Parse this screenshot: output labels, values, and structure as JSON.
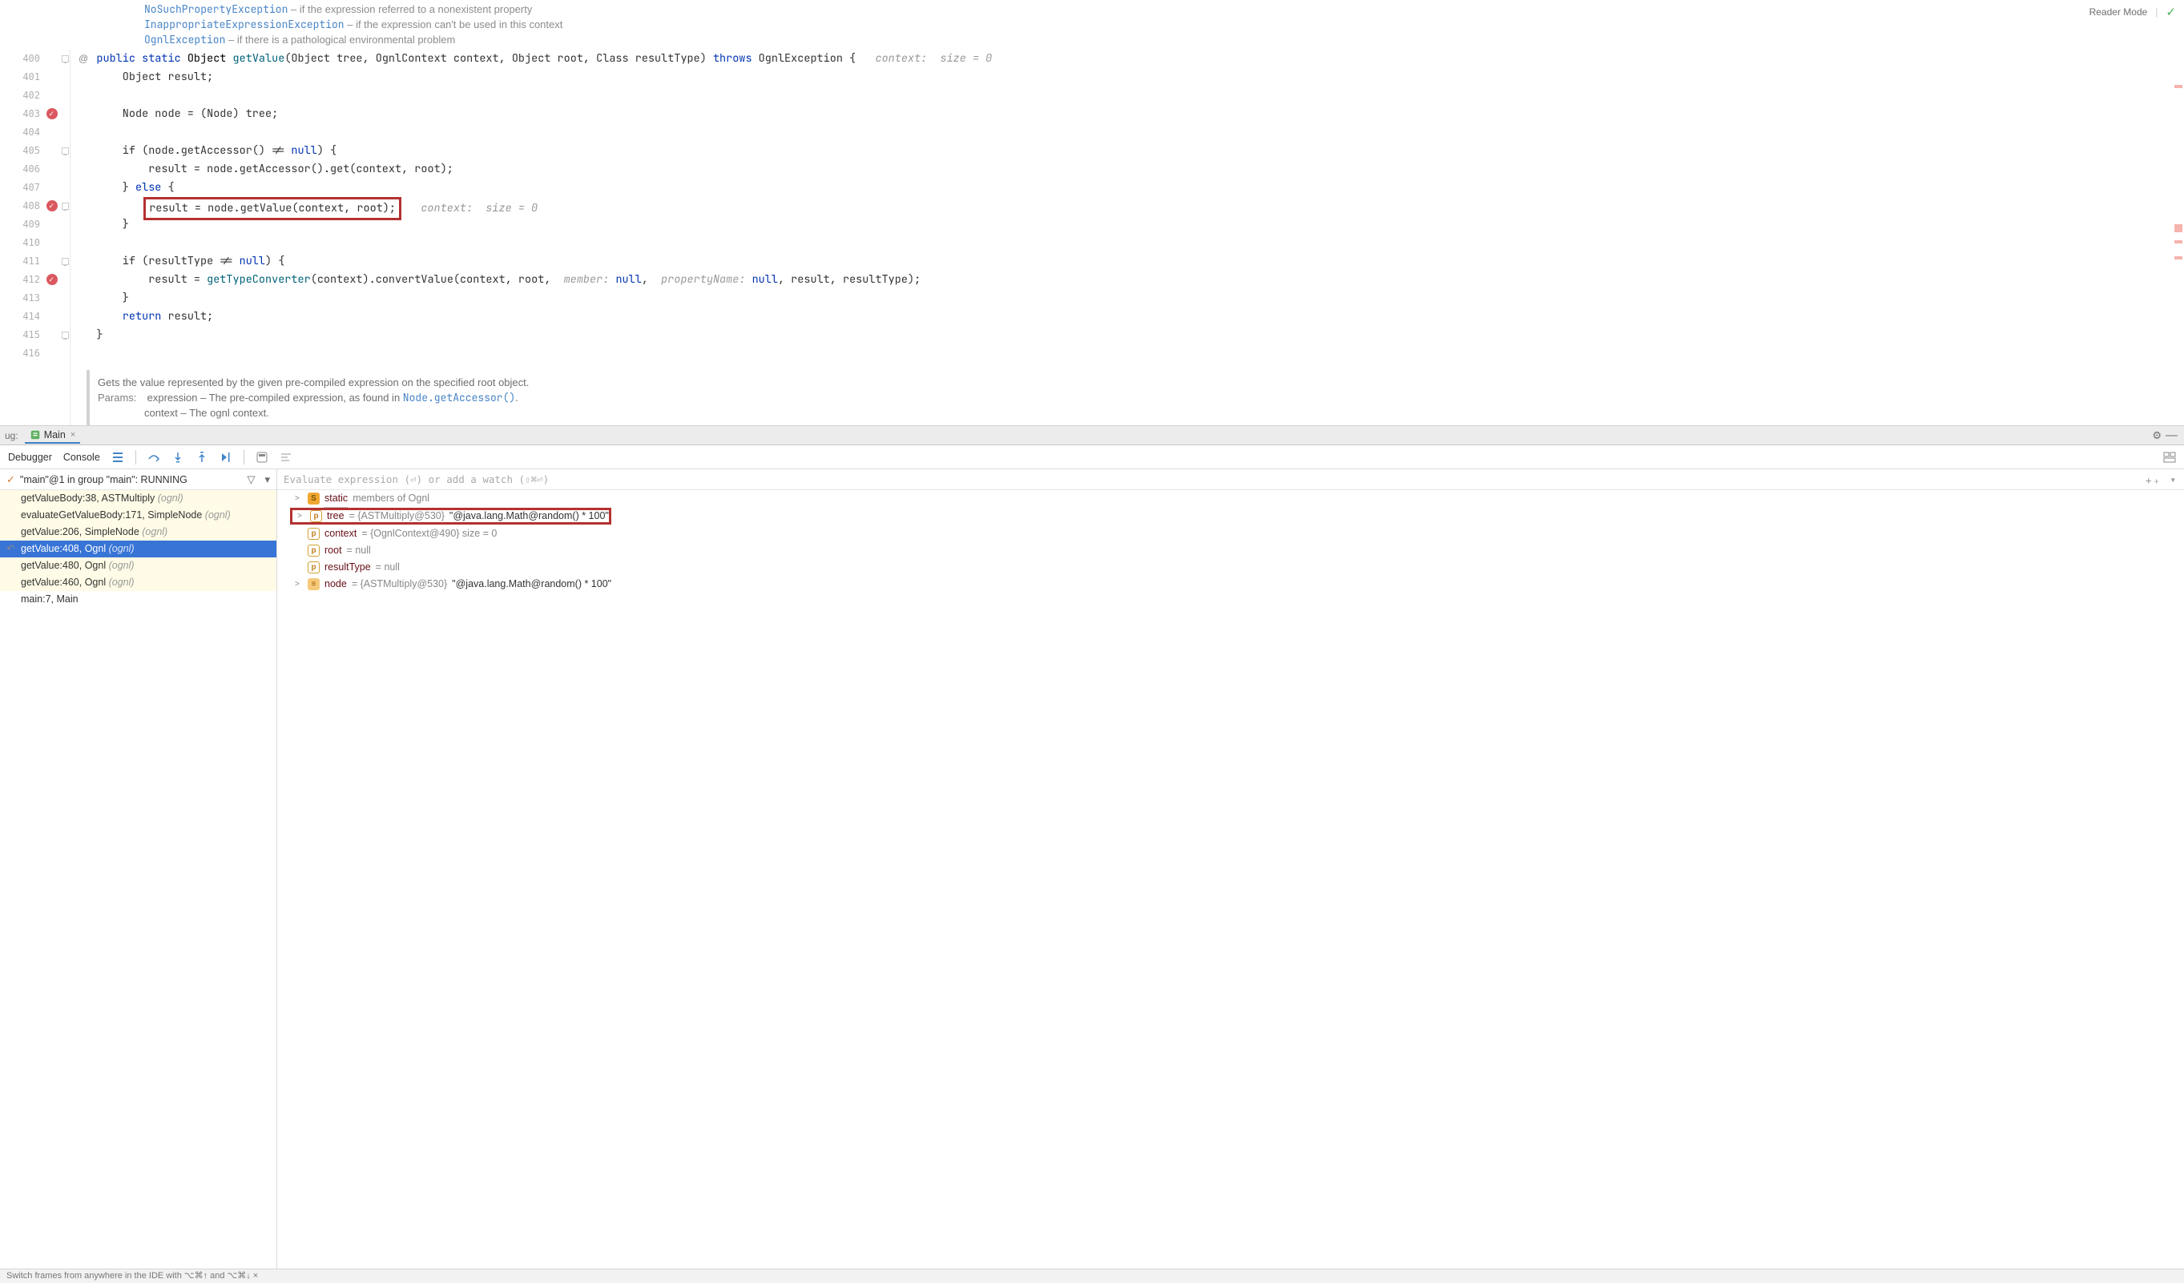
{
  "reader_mode": "Reader Mode",
  "exceptions": [
    {
      "name": "NoSuchPropertyException",
      "desc": " – if the expression referred to a nonexistent property"
    },
    {
      "name": "InappropriateExpressionException",
      "desc": " – if the expression can't be used in this context"
    },
    {
      "name": "OgnlException",
      "desc": " – if there is a pathological environmental problem"
    }
  ],
  "gutter_start": 400,
  "at_line": 400,
  "breakpoints": [
    403,
    408,
    412
  ],
  "highlighted_blue": 408,
  "highlighted_red": [
    403,
    412
  ],
  "code_lines": {
    "400": {
      "pre": "    ",
      "tokens": [
        {
          "t": "public ",
          "c": "kw"
        },
        {
          "t": "static ",
          "c": "kw"
        },
        {
          "t": "Object ",
          "c": "type"
        },
        {
          "t": "getValue",
          "c": "method"
        },
        {
          "t": "(Object tree, OgnlContext context, Object root, Class<?> resultType) "
        },
        {
          "t": "throws ",
          "c": "kw"
        },
        {
          "t": "OgnlException {   "
        },
        {
          "t": "context:  size = 0",
          "c": "hint"
        }
      ]
    },
    "401": {
      "pre": "        ",
      "tokens": [
        {
          "t": "Object result;"
        }
      ]
    },
    "402": {
      "pre": "",
      "tokens": [
        {
          "t": ""
        }
      ]
    },
    "403": {
      "pre": "        ",
      "tokens": [
        {
          "t": "Node node = (Node) tree;"
        }
      ]
    },
    "404": {
      "pre": "",
      "tokens": [
        {
          "t": ""
        }
      ]
    },
    "405": {
      "pre": "        ",
      "tokens": [
        {
          "t": "if "
        },
        {
          "t": "(node.getAccessor() != "
        },
        {
          "t": "null",
          "c": "kw"
        },
        {
          "t": ") {"
        }
      ]
    },
    "406": {
      "pre": "            ",
      "tokens": [
        {
          "t": "result = node.getAccessor().get(context, root);"
        }
      ]
    },
    "407": {
      "pre": "        ",
      "tokens": [
        {
          "t": "} "
        },
        {
          "t": "else",
          "c": "kw"
        },
        {
          "t": " {"
        }
      ]
    },
    "408": {
      "pre": "            ",
      "boxed": true,
      "tokens": [
        {
          "t": "result = node.getValue(context, root);"
        }
      ],
      "hint": "   context:  size = 0"
    },
    "409": {
      "pre": "        ",
      "tokens": [
        {
          "t": "}"
        }
      ]
    },
    "410": {
      "pre": "",
      "tokens": [
        {
          "t": ""
        }
      ]
    },
    "411": {
      "pre": "        ",
      "tokens": [
        {
          "t": "if "
        },
        {
          "t": "(resultType != "
        },
        {
          "t": "null",
          "c": "kw"
        },
        {
          "t": ") {"
        }
      ]
    },
    "412": {
      "pre": "            ",
      "tokens": [
        {
          "t": "result = "
        },
        {
          "t": "getTypeConverter",
          "c": "method i"
        },
        {
          "t": "(context).convertValue(context, root,  "
        },
        {
          "t": "member: ",
          "c": "hint"
        },
        {
          "t": "null",
          "c": "kw"
        },
        {
          "t": ",  "
        },
        {
          "t": "propertyName: ",
          "c": "hint"
        },
        {
          "t": "null",
          "c": "kw"
        },
        {
          "t": ", result, resultType);"
        }
      ]
    },
    "413": {
      "pre": "        ",
      "tokens": [
        {
          "t": "}"
        }
      ]
    },
    "414": {
      "pre": "        ",
      "tokens": [
        {
          "t": "return ",
          "c": "kw"
        },
        {
          "t": "result;"
        }
      ]
    },
    "415": {
      "pre": "    ",
      "tokens": [
        {
          "t": "}"
        }
      ]
    },
    "416": {
      "pre": "",
      "tokens": [
        {
          "t": ""
        }
      ]
    }
  },
  "doc": {
    "summary": "Gets the value represented by the given pre-compiled expression on the specified root object.",
    "params_label": "Params:",
    "p1": "expression – The pre-compiled expression, as found in ",
    "p1_link": "Node.getAccessor()",
    "p1_end": ".",
    "p2": "context – The ognl context."
  },
  "debug_label": "ug:",
  "run_tab": "Main",
  "toolbar_tabs": {
    "debugger": "Debugger",
    "console": "Console"
  },
  "thread_line": "\"main\"@1 in group \"main\": RUNNING",
  "frames": [
    {
      "txt": "getValueBody:38, ASTMultiply",
      "pkg": "(ognl)"
    },
    {
      "txt": "evaluateGetValueBody:171, SimpleNode",
      "pkg": "(ognl)"
    },
    {
      "txt": "getValue:206, SimpleNode",
      "pkg": "(ognl)"
    },
    {
      "txt": "getValue:408, Ognl",
      "pkg": "(ognl)",
      "sel": true,
      "dropped": true
    },
    {
      "txt": "getValue:480, Ognl",
      "pkg": "(ognl)"
    },
    {
      "txt": "getValue:460, Ognl",
      "pkg": "(ognl)"
    },
    {
      "txt": "main:7, Main",
      "pkg": "",
      "plain": true
    }
  ],
  "watch_placeholder": "Evaluate expression (⏎) or add a watch (⇧⌘⏎)",
  "vars": [
    {
      "exp": ">",
      "b": "s",
      "name": "static",
      "rest": " members of Ognl",
      "name_dotted": true
    },
    {
      "exp": ">",
      "b": "p",
      "name": "tree",
      "rest": " = {ASTMultiply@530} ",
      "str": "\"@java.lang.Math@random() * 100\"",
      "boxed": true
    },
    {
      "exp": " ",
      "b": "p",
      "name": "context",
      "rest": " = {OgnlContext@490}  size = 0"
    },
    {
      "exp": " ",
      "b": "p",
      "name": "root",
      "rest": " = null"
    },
    {
      "exp": " ",
      "b": "p",
      "name": "resultType",
      "rest": " = null"
    },
    {
      "exp": ">",
      "b": "f",
      "name": "node",
      "rest": " = {ASTMultiply@530} ",
      "str": "\"@java.lang.Math@random() * 100\""
    }
  ],
  "status": "Switch frames from anywhere in the IDE with ⌥⌘↑ and ⌥⌘↓ ×"
}
